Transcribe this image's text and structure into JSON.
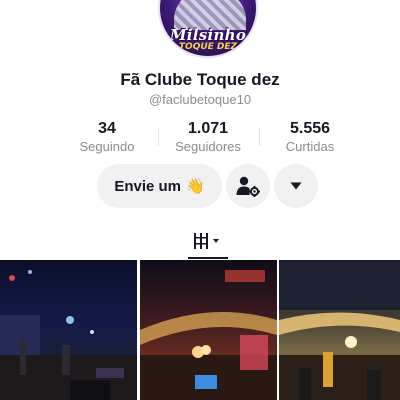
{
  "profile": {
    "display_name": "Fã Clube Toque dez",
    "handle": "@faclubetoque10",
    "avatar_logo_line1": "Milsinho",
    "avatar_logo_line2": "TOQUE DEZ"
  },
  "stats": [
    {
      "value": "34",
      "label": "Seguindo"
    },
    {
      "value": "1.071",
      "label": "Seguidores"
    },
    {
      "value": "5.556",
      "label": "Curtidas"
    }
  ],
  "actions": {
    "message_label": "Envie um",
    "message_emoji": "👋",
    "follow_icon": "person-gear-icon",
    "more_icon": "caret-down-icon"
  },
  "tabs": {
    "videos_icon": "grid-icon"
  },
  "colors": {
    "text": "#161823",
    "muted": "#8a8b91",
    "button_bg": "#f1f1f2"
  }
}
